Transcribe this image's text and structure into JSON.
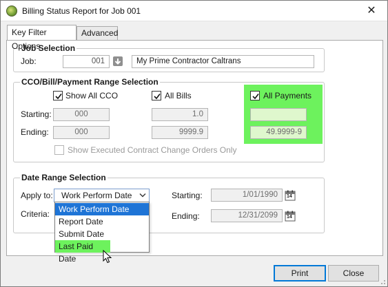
{
  "window": {
    "title": "Billing Status Report for Job 001",
    "close_glyph": "✕"
  },
  "tabs": [
    {
      "label": "Key Filter Options",
      "active": true
    },
    {
      "label": "Advanced",
      "active": false
    }
  ],
  "job_selection": {
    "title": "Job Selection",
    "job_label": "Job:",
    "job_value": "001",
    "job_name": "My Prime Contractor Caltrans"
  },
  "range_selection": {
    "title": "CCO/Bill/Payment Range Selection",
    "show_all_cco": {
      "label": "Show All CCO",
      "checked": true
    },
    "all_bills": {
      "label": "All Bills",
      "checked": true
    },
    "all_payments": {
      "label": "All Payments",
      "checked": true
    },
    "starting_label": "Starting:",
    "ending_label": "Ending:",
    "cco_start": "000",
    "cco_end": "000",
    "bill_start": "1.0",
    "bill_end": "9999.9",
    "payment_start": "",
    "payment_end": "49.9999-9",
    "show_executed": {
      "label": "Show Executed Contract Change Orders Only",
      "checked": false
    }
  },
  "date_range": {
    "title": "Date Range Selection",
    "apply_to_label": "Apply to:",
    "apply_to_value": "Work Perform Date",
    "criteria_label": "Criteria:",
    "options": [
      "Work Perform Date",
      "Report Date",
      "Submit Date",
      "Last Paid Date"
    ],
    "starting_label": "Starting:",
    "starting_value": "1/01/1990",
    "ending_label": "Ending:",
    "ending_value": "12/31/2099",
    "calendar_day": "14"
  },
  "buttons": {
    "print": "Print",
    "close": "Close"
  },
  "colors": {
    "highlight": "#6df25d",
    "selection": "#1e74d6"
  }
}
